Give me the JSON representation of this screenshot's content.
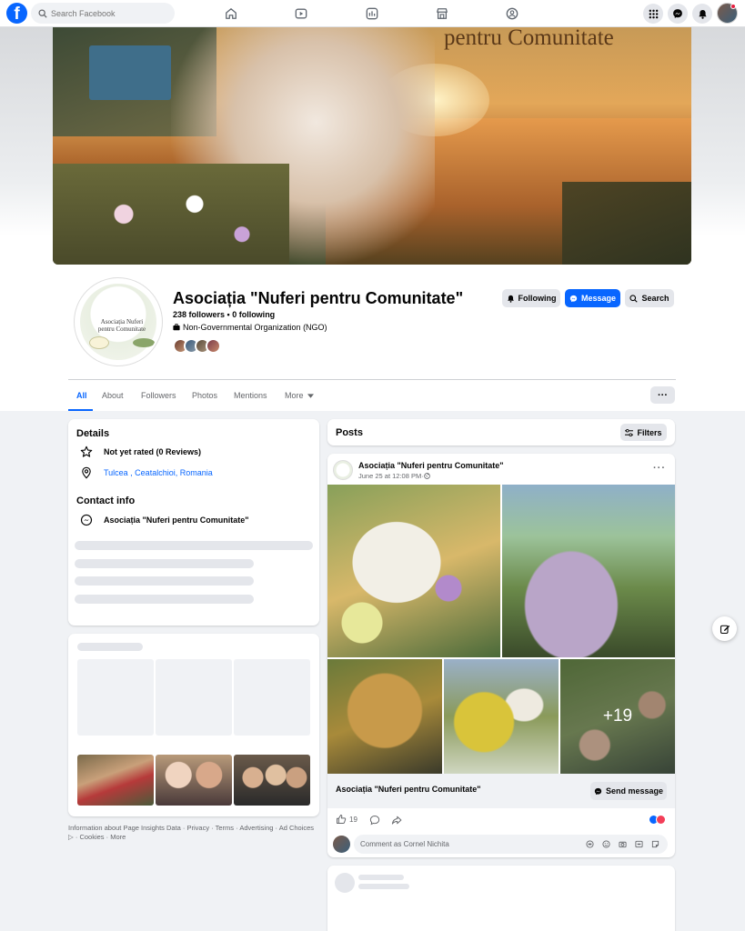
{
  "topbar": {
    "logo_letter": "f",
    "search_placeholder": "Search Facebook",
    "nav_icons": [
      "home-icon",
      "video-icon",
      "news-feed-icon",
      "marketplace-icon",
      "groups-icon"
    ],
    "right_icons": [
      "menu-grid-icon",
      "messenger-icon",
      "notifications-bell-icon"
    ]
  },
  "cover": {
    "overlay_text": "pentru Comunitate"
  },
  "profile": {
    "logo_text_line1": "Asociația Nuferi",
    "logo_text_line2": "pentru Comunitate",
    "name": "Asociația \"Nuferi pentru Comunitate\"",
    "followers": "238 followers",
    "separator": " • ",
    "following": "0 following",
    "category": "Non-Governmental Organization (NGO)"
  },
  "actions": {
    "following": "Following",
    "message": "Message",
    "search": "Search"
  },
  "tabs": [
    "All",
    "About",
    "Followers",
    "Photos",
    "Mentions",
    "More"
  ],
  "more_dots": "···",
  "details": {
    "title": "Details",
    "rating": "Not yet rated (0 Reviews)",
    "location": "Tulcea , Ceatalchioi, Romania",
    "contact_title": "Contact info",
    "contact_name": "Asociația \"Nuferi pentru Comunitate\""
  },
  "footer": {
    "links": [
      "Information about Page Insights Data",
      "Privacy",
      "Terms",
      "Advertising",
      "Ad Choices",
      "Cookies",
      "More"
    ],
    "sep": " · ",
    "adchoices_glyph": "▷"
  },
  "posts": {
    "title": "Posts",
    "filters": "Filters",
    "post": {
      "author": "Asociația \"Nuferi pentru Comunitate\"",
      "date": "June 25 at 12:08 PM",
      "date_sep": " · ",
      "more_photos": "+19",
      "caption_name": "Asociația \"Nuferi pentru Comunitate\"",
      "send_message": "Send message",
      "reaction_count": "19",
      "comment_placeholder": "Comment as Cornel Nichita"
    }
  },
  "colors": {
    "brand_blue": "#0866ff",
    "background": "#f0f2f5",
    "secondary_text": "#65676b"
  }
}
